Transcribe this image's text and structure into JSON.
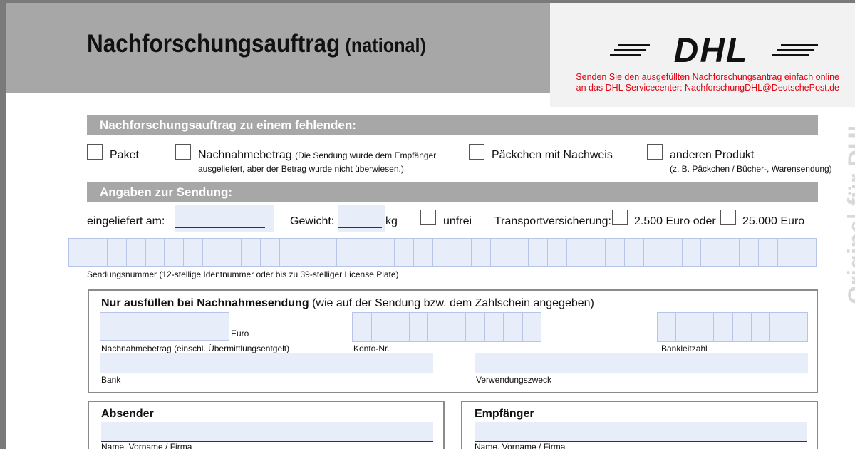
{
  "header": {
    "title": "Nachforschungsauftrag",
    "subtitle": "(national)",
    "logo_text": "DHL",
    "note_line1": "Senden Sie den ausgefüllten Nachforschungsantrag einfach online",
    "note_line2": "an das DHL Servicecenter: NachforschungDHL@DeutschePost.de",
    "vertical_label": "Original für DHL"
  },
  "colors": {
    "brand_red": "#e3000f",
    "band_gray": "#a7a7a7",
    "field_blue": "#e8edfa"
  },
  "section1": {
    "title": "Nachforschungsauftrag zu einem fehlenden:",
    "options": [
      {
        "label": "Paket",
        "note": ""
      },
      {
        "label": "Nachnahmebetrag",
        "note_inline": "(Die Sendung wurde dem Empfänger",
        "note": "ausgeliefert, aber der Betrag wurde nicht überwiesen.)"
      },
      {
        "label": "Päckchen mit Nachweis",
        "note": ""
      },
      {
        "label": "anderen Produkt",
        "note": "(z. B. Päckchen / Bücher-, Warensendung)"
      }
    ]
  },
  "section2": {
    "title": "Angaben zur Sendung:",
    "eingeliefert_label": "eingeliefert am:",
    "gewicht_label": "Gewicht:",
    "kg_label": "kg",
    "unfrei_label": "unfrei",
    "versicherung_label": "Transportversicherung:",
    "opt1_label": "2.500 Euro oder",
    "opt2_label": "25.000 Euro",
    "sendungsnummer_label": "Sendungsnummer (12-stellige Identnummer oder bis zu 39-stelliger License Plate)"
  },
  "cod": {
    "title": "Nur ausfüllen bei Nachnahmesendung",
    "title_note": "(wie auf der Sendung bzw. dem Zahlschein angegeben)",
    "euro_label": "Euro",
    "amount_label": "Nachnahmebetrag (einschl. Übermittlungsentgelt)",
    "konto_label": "Konto-Nr.",
    "blz_label": "Bankleitzahl",
    "bank_label": "Bank",
    "zweck_label": "Verwendungszweck"
  },
  "sender": {
    "title": "Absender",
    "name_label": "Name, Vorname / Firma"
  },
  "recipient": {
    "title": "Empfänger",
    "name_label": "Name, Vorname / Firma"
  }
}
